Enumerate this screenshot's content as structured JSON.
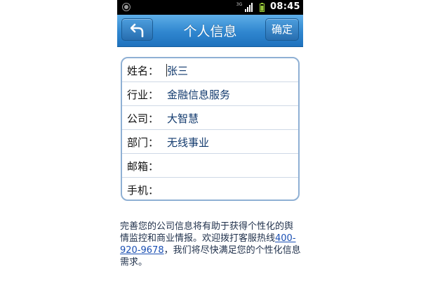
{
  "status_bar": {
    "network": "3G",
    "time": "08:45"
  },
  "header": {
    "title": "个人信息",
    "back_icon": "back-arrow-icon",
    "confirm_label": "确定"
  },
  "form": {
    "rows": [
      {
        "label": "姓名：",
        "value": "张三"
      },
      {
        "label": "行业：",
        "value": "金融信息服务"
      },
      {
        "label": "公司：",
        "value": "大智慧"
      },
      {
        "label": "部门：",
        "value": "无线事业"
      },
      {
        "label": "邮箱：",
        "value": ""
      },
      {
        "label": "手机：",
        "value": ""
      }
    ]
  },
  "hint": {
    "text_before": "完善您的公司信息将有助于获得个性化的舆情监控和商业情报。欢迎拨打客服热线",
    "phone": "400-920-9678",
    "text_after": "，我们将尽快满足您的个性化信息需求。"
  },
  "colors": {
    "header_gradient_top": "#5eaee8",
    "header_gradient_bottom": "#1f72bd",
    "card_border": "#8fb0d4",
    "value_text": "#123a6e",
    "link": "#1a4fb3"
  }
}
